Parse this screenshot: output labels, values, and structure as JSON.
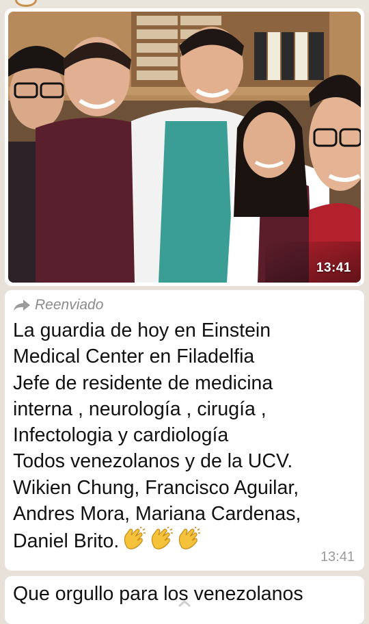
{
  "photo_message": {
    "time": "13:41",
    "image_description_icon": "group-photo"
  },
  "text_message": {
    "forwarded_label": "Reenviado",
    "lines": [
      "La guardia de hoy en Einstein",
      "Medical Center en Filadelfia",
      "Jefe de residente de medicina",
      "interna , neurología , cirugía ,",
      "Infectologia y cardiología",
      "Todos venezolanos y de la UCV.",
      "Wikien Chung, Francisco Aguilar,",
      "Andres Mora, Mariana Cardenas,",
      "Daniel Brito."
    ],
    "emoji": "clapping-hands-icon",
    "time": "13:41"
  },
  "next_message": {
    "text": "Que orgullo para los venezolanos"
  },
  "colors": {
    "chat_background": "#e7e1d9",
    "bubble": "#ffffff",
    "meta_text": "#9a9a9a"
  }
}
